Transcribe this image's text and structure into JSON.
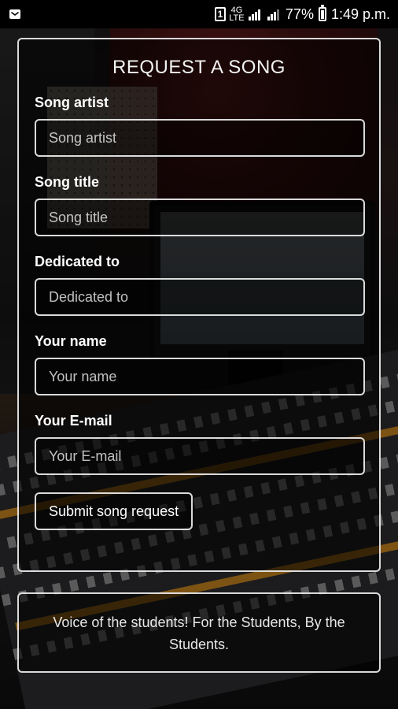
{
  "status_bar": {
    "sim_slot": "1",
    "network_type_top": "4G",
    "network_type_bottom": "LTE",
    "battery_percent": "77%",
    "time": "1:49 p.m."
  },
  "form": {
    "title": "REQUEST A SONG",
    "fields": [
      {
        "label": "Song artist",
        "placeholder": "Song artist",
        "value": ""
      },
      {
        "label": "Song title",
        "placeholder": "Song title",
        "value": ""
      },
      {
        "label": "Dedicated to",
        "placeholder": "Dedicated to",
        "value": ""
      },
      {
        "label": "Your name",
        "placeholder": "Your name",
        "value": ""
      },
      {
        "label": "Your E-mail",
        "placeholder": "Your E-mail",
        "value": ""
      }
    ],
    "submit_label": "Submit song request"
  },
  "footer": {
    "text": "Voice of the students! For the Students, By the Students."
  }
}
